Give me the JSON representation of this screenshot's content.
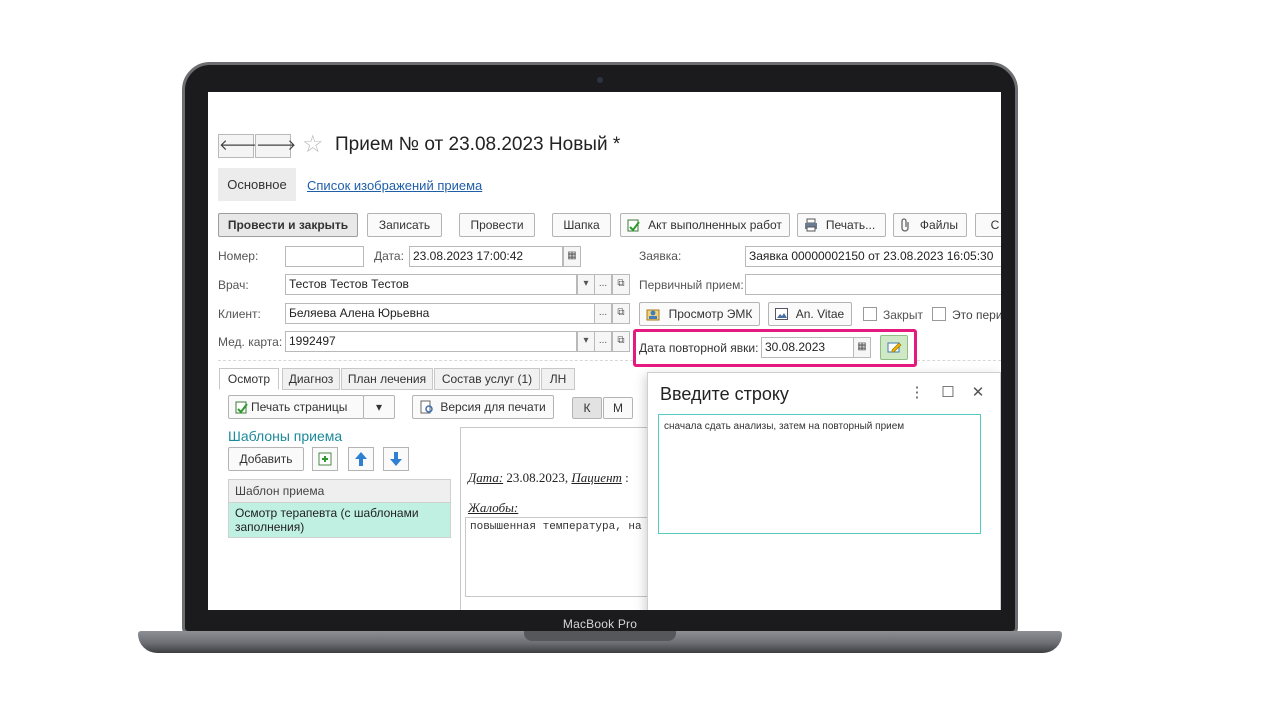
{
  "device": {
    "brand": "MacBook Pro"
  },
  "header": {
    "back": "🡐",
    "forward": "🡒",
    "title": "Прием №  от 23.08.2023 Новый *"
  },
  "tabs_top": {
    "main": "Основное",
    "link": "Список изображений приема"
  },
  "toolbar": {
    "post_close": "Провести и закрыть",
    "save": "Записать",
    "post": "Провести",
    "header": "Шапка",
    "act": "Акт выполненных работ",
    "print": "Печать...",
    "files": "Файлы",
    "more": "С"
  },
  "form": {
    "number_label": "Номер:",
    "number_value": "",
    "date_label": "Дата:",
    "date_value": "23.08.2023 17:00:42",
    "request_label": "Заявка:",
    "request_value": "Заявка 00000002150 от 23.08.2023 16:05:30",
    "doctor_label": "Врач:",
    "doctor_value": "Тестов Тестов Тестов",
    "primary_label": "Первичный прием:",
    "primary_value": "",
    "client_label": "Клиент:",
    "client_value": "Беляева Алена Юрьевна",
    "emk_button": "Просмотр ЭМК",
    "anvitae_button": "An. Vitae",
    "closed_label": "Закрыт",
    "this_is_label": "Это пери",
    "card_label": "Мед. карта:",
    "card_value": "1992497",
    "revisit_label": "Дата повторной явки:",
    "revisit_value": "30.08.2023",
    "more": "...",
    "open": "⧉",
    "arrow": "▾"
  },
  "sub_tabs": [
    "Осмотр",
    "Диагноз",
    "План лечения",
    "Состав услуг (1)",
    "ЛН"
  ],
  "exam": {
    "print_pages": "Печать страницы",
    "print_version": "Версия для печати",
    "k": "К",
    "m": "М",
    "templates_title": "Шаблоны приема",
    "add": "Добавить",
    "grid_header": "Шаблон приема",
    "grid_row": "Осмотр терапевта (с шаблонами заполнения)",
    "doc_date_label": "Дата:",
    "doc_date_value": " 23.08.2023,",
    "doc_patient_label": "Пациент",
    "doc_patient_rest": ":",
    "complaints_label": "Жалобы:",
    "complaints_text": "повышенная температура, на"
  },
  "dialog": {
    "title": "Введите строку",
    "menu": "⋮",
    "maximize": "☐",
    "close": "✕",
    "text": "сначала сдать анализы, затем на повторный прием"
  },
  "colors": {
    "highlight": "#e6197f",
    "accent_teal": "#1b8a9a",
    "selected_row": "#bff0e1",
    "link": "#1f5fa8"
  }
}
